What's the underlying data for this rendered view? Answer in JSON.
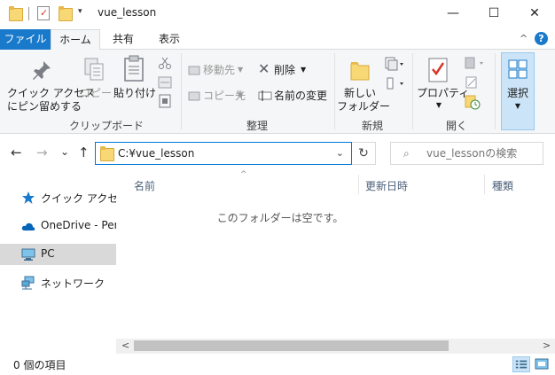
{
  "window": {
    "title": "vue_lesson",
    "controls": {
      "minimize": "—",
      "maximize": "☐",
      "close": "✕"
    }
  },
  "quick_access": {
    "dropdown": "▾"
  },
  "ribbon_tabs": [
    {
      "label": "ファイル"
    },
    {
      "label": "ホーム"
    },
    {
      "label": "共有"
    },
    {
      "label": "表示"
    }
  ],
  "ribbon_controls": {
    "collapse": "^",
    "help": "?"
  },
  "ribbon": {
    "clipboard": {
      "label": "クリップボード",
      "pin_quick_access": [
        "クイック アクセス",
        "にピン留めする"
      ],
      "copy": "コピー",
      "paste": "貼り付け"
    },
    "organize": {
      "label": "整理",
      "move_to": "移動先",
      "copy_to": "コピー先",
      "delete": "削除",
      "rename": "名前の変更"
    },
    "new": {
      "label": "新規",
      "new_folder": [
        "新しい",
        "フォルダー"
      ]
    },
    "open": {
      "label": "開く",
      "properties": "プロパティ"
    },
    "select": {
      "label": "選択"
    }
  },
  "navigation": {
    "back": "←",
    "forward": "→",
    "recent": "⌄",
    "up": "↑",
    "address": "C:¥vue_lesson",
    "address_dropdown": "⌄",
    "refresh": "↻",
    "search_placeholder": "vue_lessonの検索",
    "search_icon": "⌕"
  },
  "nav_pane": {
    "items": [
      {
        "label": "クイック アクセス",
        "icon": "star-icon",
        "selected": false
      },
      {
        "label": "OneDrive - Perso",
        "icon": "cloud-icon",
        "selected": false
      },
      {
        "label": "PC",
        "icon": "computer-icon",
        "selected": true
      },
      {
        "label": "ネットワーク",
        "icon": "network-icon",
        "selected": false
      }
    ]
  },
  "content": {
    "columns": [
      "名前",
      "更新日時",
      "種類"
    ],
    "sort_indicator": "^",
    "empty_message": "このフォルダーは空です。"
  },
  "scrollbar": {
    "left": "<",
    "right": ">"
  },
  "status": {
    "item_count": "0 個の項目"
  },
  "colors": {
    "accent": "#1979ca",
    "folder": "#f8d775",
    "ribbon_bg": "#f5f6f7",
    "selected_nav": "#d9d9d9",
    "column_header_text": "#4c607a"
  }
}
